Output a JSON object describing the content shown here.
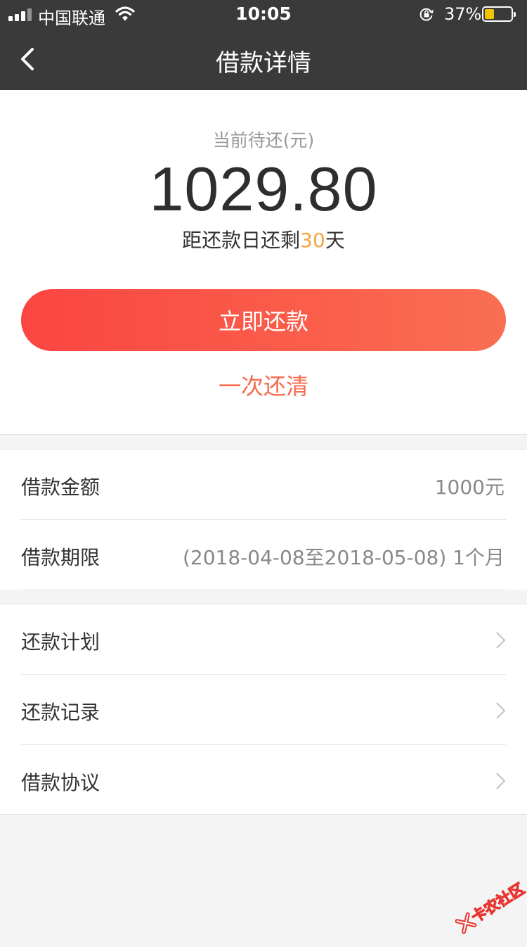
{
  "status_bar": {
    "carrier": "中国联通",
    "time": "10:05",
    "battery_percent": "37%",
    "battery_level": 0.37,
    "icons": [
      "signal-icon",
      "wifi-icon",
      "rotation-lock-icon",
      "battery-icon"
    ]
  },
  "nav": {
    "title": "借款详情",
    "back_icon": "chevron-left-icon"
  },
  "summary": {
    "pending_label": "当前待还(元)",
    "pending_amount": "1029.80",
    "days_prefix": "距还款日还剩",
    "days_value": "30",
    "days_suffix": "天",
    "repay_button": "立即还款",
    "payoff_link": "一次还清"
  },
  "loan_info": [
    {
      "label": "借款金额",
      "value": "1000元"
    },
    {
      "label": "借款期限",
      "value": "(2018-04-08至2018-05-08) 1个月"
    }
  ],
  "menu": [
    {
      "label": "还款计划"
    },
    {
      "label": "还款记录"
    },
    {
      "label": "借款协议"
    }
  ],
  "watermark": {
    "text": "卡农社区"
  },
  "colors": {
    "header_bg": "#3a3a3a",
    "accent_start": "#fb4541",
    "accent_end": "#f96f52",
    "highlight": "#f5a33a"
  }
}
